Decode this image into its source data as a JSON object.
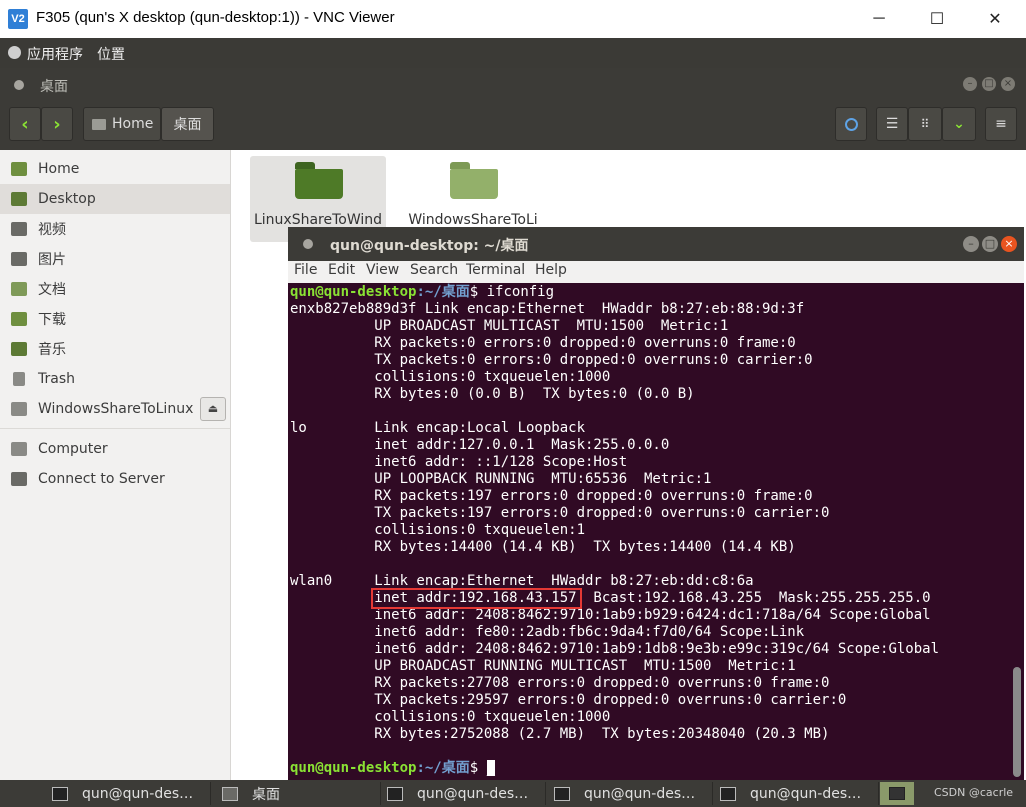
{
  "window": {
    "title": "F305 (qun's X desktop (qun-desktop:1)) - VNC Viewer",
    "app_logo": "V2",
    "minimize": "─",
    "maximize": "☐",
    "close": "✕"
  },
  "top_panel": {
    "applications": "应用程序",
    "places": "位置"
  },
  "file_manager": {
    "title": "桌面",
    "breadcrumb": [
      "Home",
      "桌面"
    ],
    "sidebar": [
      {
        "label": "Home",
        "icon": "home-icon"
      },
      {
        "label": "Desktop",
        "icon": "desktop-icon",
        "selected": true
      },
      {
        "label": "视频",
        "icon": "video-icon"
      },
      {
        "label": "图片",
        "icon": "pictures-icon"
      },
      {
        "label": "文档",
        "icon": "documents-icon"
      },
      {
        "label": "下载",
        "icon": "downloads-icon"
      },
      {
        "label": "音乐",
        "icon": "music-icon"
      },
      {
        "label": "Trash",
        "icon": "trash-icon"
      },
      {
        "label": "WindowsShareToLinux",
        "icon": "drive-icon"
      },
      {
        "label": "Computer",
        "icon": "computer-icon"
      },
      {
        "label": "Connect to Server",
        "icon": "server-icon"
      }
    ],
    "folders": [
      {
        "name": "LinuxShareToWind"
      },
      {
        "name": "WindowsShareToLi"
      }
    ]
  },
  "terminal": {
    "title": "qun@qun-desktop: ~/桌面",
    "menu": [
      "File",
      "Edit",
      "View",
      "Search",
      "Terminal",
      "Help"
    ],
    "prompt_user": "qun@qun-desktop",
    "prompt_path": ":~/桌面",
    "prompt_symbol": "$",
    "command": " ifconfig",
    "output_lines": [
      "enxb827eb889d3f Link encap:Ethernet  HWaddr b8:27:eb:88:9d:3f",
      "          UP BROADCAST MULTICAST  MTU:1500  Metric:1",
      "          RX packets:0 errors:0 dropped:0 overruns:0 frame:0",
      "          TX packets:0 errors:0 dropped:0 overruns:0 carrier:0",
      "          collisions:0 txqueuelen:1000",
      "          RX bytes:0 (0.0 B)  TX bytes:0 (0.0 B)",
      "",
      "lo        Link encap:Local Loopback",
      "          inet addr:127.0.0.1  Mask:255.0.0.0",
      "          inet6 addr: ::1/128 Scope:Host",
      "          UP LOOPBACK RUNNING  MTU:65536  Metric:1",
      "          RX packets:197 errors:0 dropped:0 overruns:0 frame:0",
      "          TX packets:197 errors:0 dropped:0 overruns:0 carrier:0",
      "          collisions:0 txqueuelen:1",
      "          RX bytes:14400 (14.4 KB)  TX bytes:14400 (14.4 KB)",
      "",
      "wlan0     Link encap:Ethernet  HWaddr b8:27:eb:dd:c8:6a",
      "          inet addr:192.168.43.157  Bcast:192.168.43.255  Mask:255.255.255.0",
      "          inet6 addr: 2408:8462:9710:1ab9:b929:6424:dc1:718a/64 Scope:Global",
      "          inet6 addr: fe80::2adb:fb6c:9da4:f7d0/64 Scope:Link",
      "          inet6 addr: 2408:8462:9710:1ab9:1db8:9e3b:e99c:319c/64 Scope:Global",
      "          UP BROADCAST RUNNING MULTICAST  MTU:1500  Metric:1",
      "          RX packets:27708 errors:0 dropped:0 overruns:0 frame:0",
      "          TX packets:29597 errors:0 dropped:0 overruns:0 carrier:0",
      "          collisions:0 txqueuelen:1000",
      "          RX bytes:2752088 (2.7 MB)  TX bytes:20348040 (20.3 MB)",
      ""
    ],
    "highlighted_text": "inet addr:192.168.43.157",
    "highlight_color": "#e53935"
  },
  "taskbar": {
    "tasks": [
      {
        "label": "qun@qun-des…",
        "icon": "terminal-icon"
      },
      {
        "label": "桌面",
        "icon": "file-manager-icon"
      },
      {
        "label": "qun@qun-des…",
        "icon": "terminal-icon"
      },
      {
        "label": "qun@qun-des…",
        "icon": "terminal-icon"
      },
      {
        "label": "qun@qun-des…",
        "icon": "terminal-icon"
      }
    ],
    "watermark": "CSDN @cacrle"
  },
  "colors": {
    "terminal_bg": "#300a24",
    "prompt_user": "#8ae234",
    "prompt_path": "#729fcf",
    "folder_green": "#4e7a27"
  }
}
